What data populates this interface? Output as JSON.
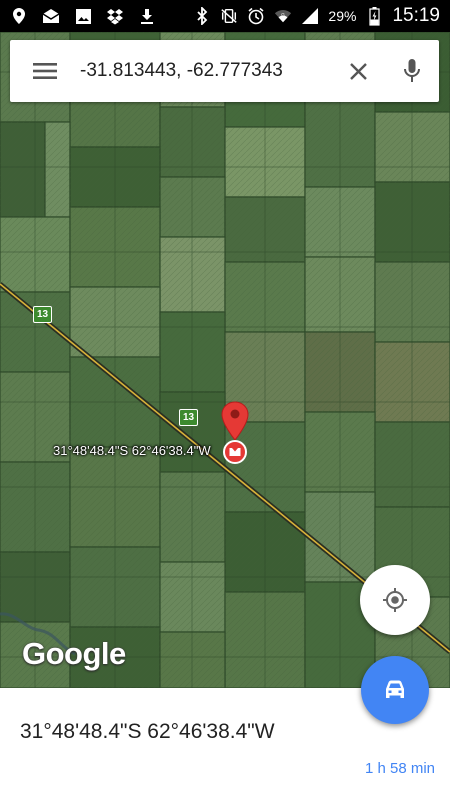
{
  "status_bar": {
    "battery_percent": "29%",
    "time": "15:19",
    "left_icons": [
      "location-icon",
      "mail-icon",
      "image-icon",
      "dropbox-icon",
      "download-icon"
    ],
    "right_icons": [
      "bluetooth-icon",
      "vibrate-icon",
      "alarm-icon",
      "wifi-icon",
      "signal-icon",
      "battery-icon"
    ]
  },
  "search": {
    "query": "-31.813443, -62.777343"
  },
  "map": {
    "pin_label": "31°48'48.4\"S 62°46'38.4\"W",
    "route_number_1": "13",
    "route_number_2": "13",
    "logo": "Google"
  },
  "place": {
    "title": "31°48'48.4\"S 62°46'38.4\"W",
    "eta": "1 h 58 min"
  },
  "colors": {
    "accent": "#4285f4",
    "pin": "#e53935",
    "route_badge": "#3d8a2f"
  }
}
